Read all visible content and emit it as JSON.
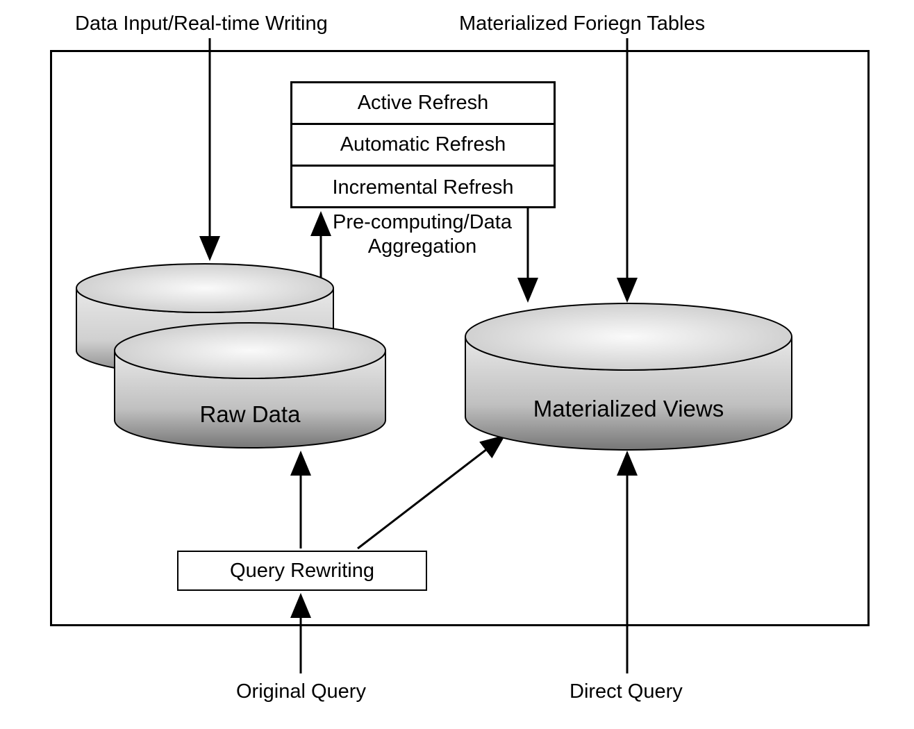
{
  "labels": {
    "topLeft": "Data Input/Real-time Writing",
    "topRight": "Materialized Foriegn Tables",
    "bottomLeft": "Original Query",
    "bottomRight": "Direct Query",
    "preComputing": "Pre-computing/Data\nAggregation"
  },
  "refresh": {
    "row1": "Active Refresh",
    "row2": "Automatic Refresh",
    "row3": "Incremental Refresh"
  },
  "queryRewriting": "Query Rewriting",
  "cylinders": {
    "rawData": "Raw Data",
    "materializedViews": "Materialized Views"
  }
}
